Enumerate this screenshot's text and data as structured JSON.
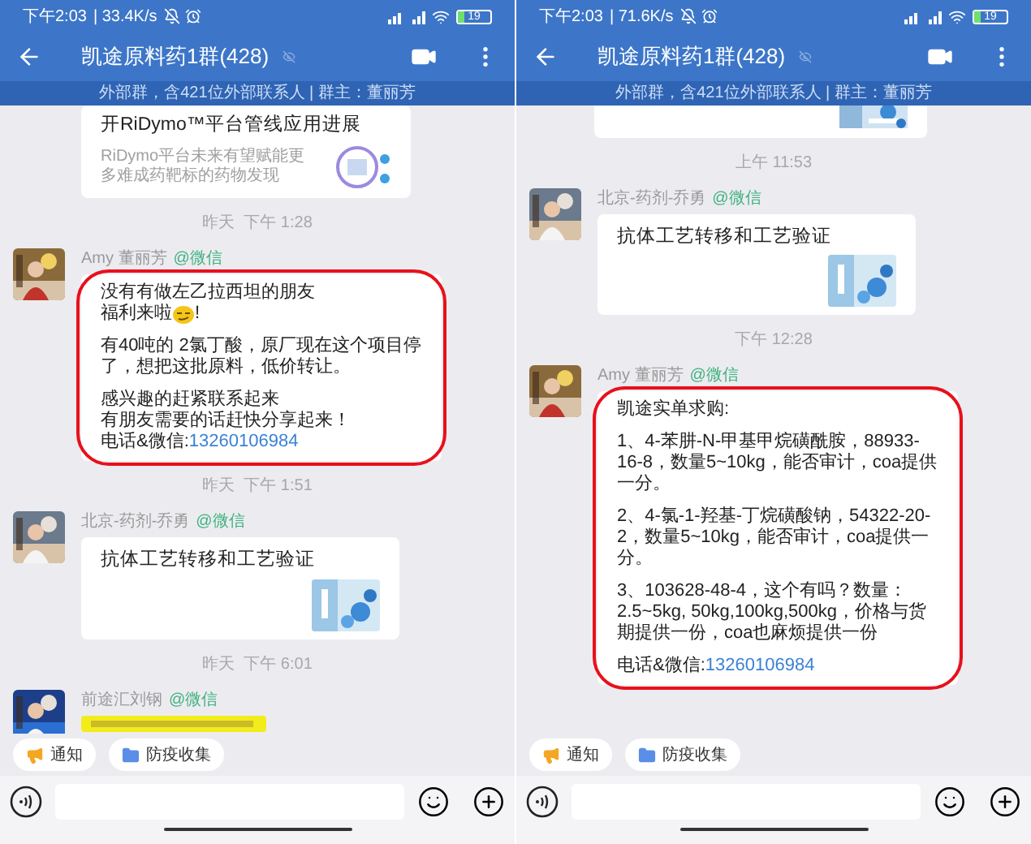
{
  "screens": [
    {
      "status_bar": {
        "time": "下午2:03",
        "speed": "| 33.4K/s",
        "battery": "19"
      },
      "header": {
        "title": "凯途原料药1群(428)",
        "subtitle": "外部群，含421位外部联系人 | 群主：董丽芳"
      },
      "messages": [
        {
          "kind": "card",
          "title": "开RiDymo™平台管线应用进展",
          "description": "RiDymo平台未来有望赋能更多难成药靶标的药物发现"
        },
        {
          "kind": "time",
          "text": "昨天  下午 1:28"
        },
        {
          "kind": "text",
          "sender": "Amy 董丽芳",
          "via": "@微信",
          "circled": true,
          "paragraphs": [
            [
              {
                "text": "没有有做左乙拉西坦的朋友"
              },
              {
                "text": "福利来啦",
                "emoji": true,
                "tail": "!"
              }
            ],
            [
              {
                "text": "有40吨的  2氯丁酸，原厂现在这个项目停了，想把这批原料，低价转让。"
              }
            ],
            [
              {
                "text": "感兴趣的赶紧联系起来"
              },
              {
                "text": "有朋友需要的话赶快分享起来！"
              }
            ]
          ],
          "contact": {
            "label": "电话&微信:",
            "phone": "13260106984"
          }
        },
        {
          "kind": "time",
          "text": "昨天  下午 1:51"
        },
        {
          "kind": "titlecard",
          "sender": "北京-药剂-乔勇",
          "via": "@微信",
          "title": "抗体工艺转移和工艺验证"
        },
        {
          "kind": "time",
          "text": "昨天  下午 6:01"
        },
        {
          "kind": "blurred",
          "sender": "前途汇刘钢",
          "via": "@微信"
        }
      ],
      "quick_actions": [
        {
          "kind": "notice",
          "label": "通知"
        },
        {
          "kind": "collect",
          "label": "防疫收集"
        }
      ]
    },
    {
      "status_bar": {
        "time": "下午2:03",
        "speed": "| 71.6K/s",
        "battery": "19"
      },
      "header": {
        "title": "凯途原料药1群(428)",
        "subtitle": "外部群，含421位外部联系人 | 群主：董丽芳"
      },
      "messages": [
        {
          "kind": "image_stub"
        },
        {
          "kind": "time",
          "text": "上午 11:53"
        },
        {
          "kind": "titlecard",
          "sender": "北京-药剂-乔勇",
          "via": "@微信",
          "title": "抗体工艺转移和工艺验证"
        },
        {
          "kind": "time",
          "text": "下午 12:28"
        },
        {
          "kind": "text",
          "sender": "Amy 董丽芳",
          "via": "@微信",
          "circled": true,
          "paragraphs": [
            [
              {
                "text": "凯途实单求购:"
              }
            ],
            [
              {
                "text": "1、4-苯肼-N-甲基甲烷磺酰胺，88933-16-8，数量5~10kg，能否审计，coa提供一分。"
              }
            ],
            [
              {
                "text": "2、4-氯-1-羟基-丁烷磺酸钠，54322-20-2，数量5~10kg，能否审计，coa提供一分。"
              }
            ],
            [
              {
                "text": "3、103628-48-4，这个有吗？数量：2.5~5kg, 50kg,100kg,500kg，价格与货期提供一份，coa也麻烦提供一份"
              }
            ]
          ],
          "contact": {
            "label": "电话&微信:",
            "phone": "13260106984"
          }
        }
      ],
      "quick_actions": [
        {
          "kind": "notice",
          "label": "通知"
        },
        {
          "kind": "collect",
          "label": "防疫收集"
        }
      ]
    }
  ]
}
